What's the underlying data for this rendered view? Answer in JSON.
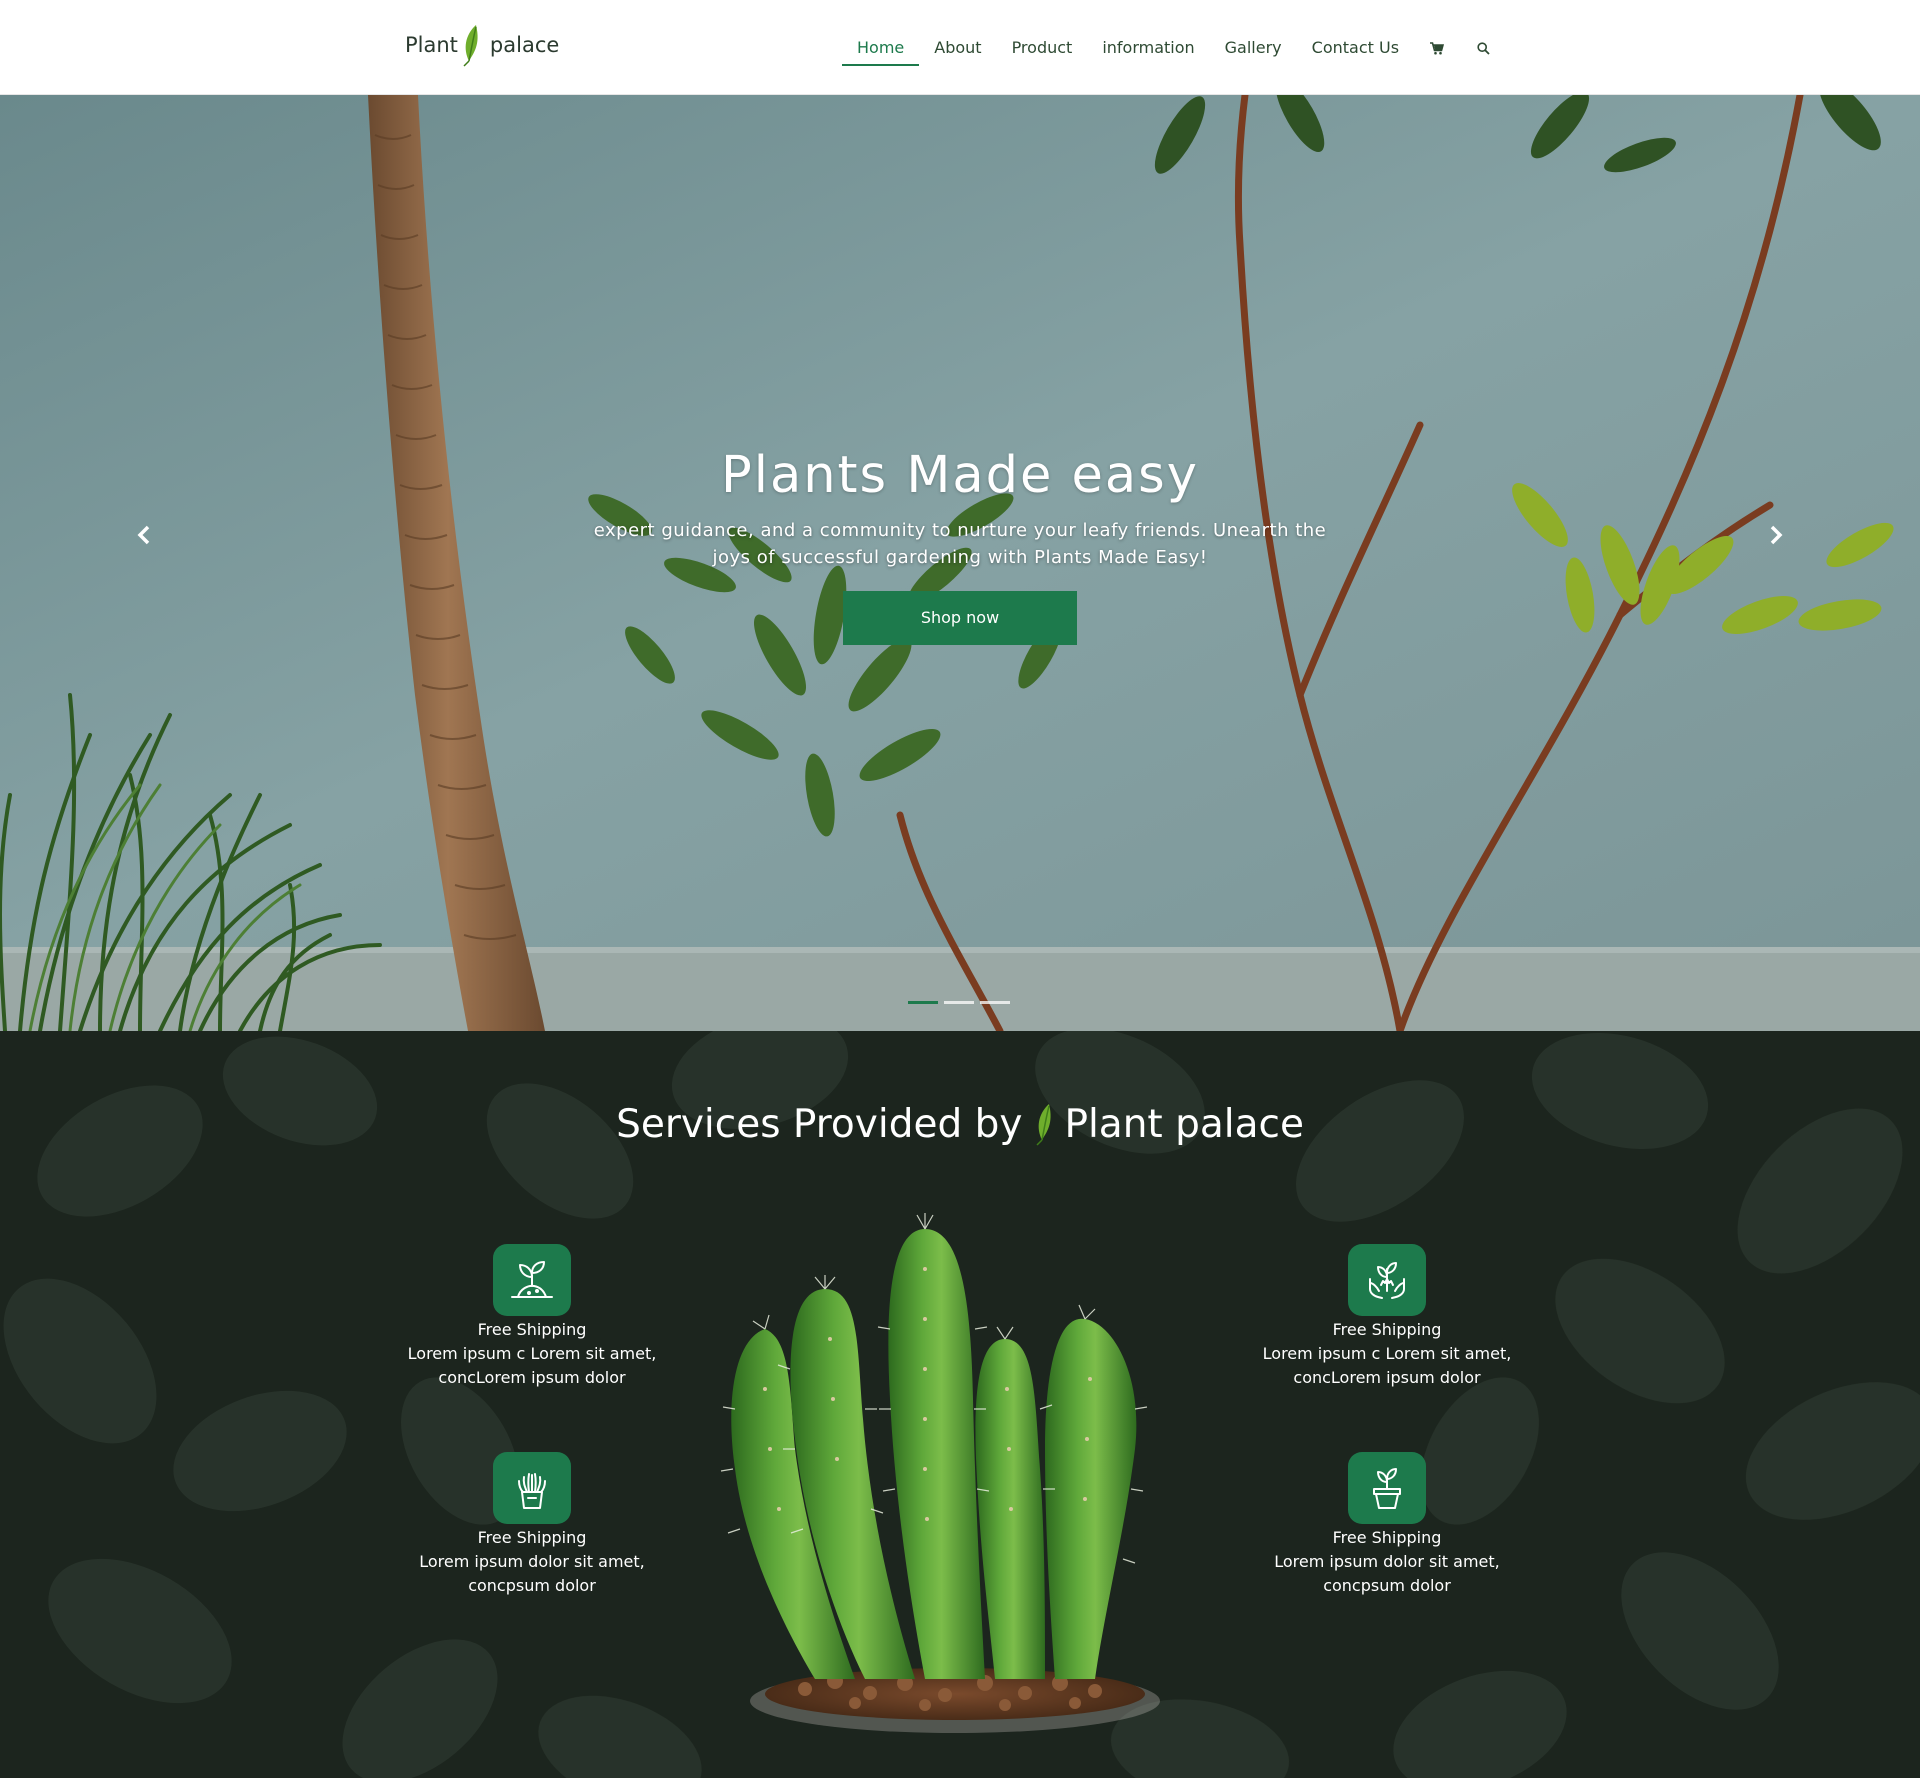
{
  "header": {
    "logo": {
      "word1": "Plant",
      "word2": "palace"
    },
    "nav": [
      {
        "label": "Home",
        "active": true
      },
      {
        "label": "About",
        "active": false
      },
      {
        "label": "Product",
        "active": false
      },
      {
        "label": "information",
        "active": false
      },
      {
        "label": "Gallery",
        "active": false
      },
      {
        "label": "Contact Us",
        "active": false
      }
    ],
    "icons": [
      "cart-icon",
      "search-icon"
    ]
  },
  "hero": {
    "title": "Plants Made easy",
    "subtitle": "expert guidance, and a community to nurture your leafy friends. Unearth the joys of successful gardening with Plants Made Easy!",
    "button": "Shop now",
    "slides": {
      "count": 3,
      "active": 1
    }
  },
  "services": {
    "title_prefix": "Services Provided by",
    "title_brand": "Plant palace",
    "features": [
      {
        "icon": "sprout-icon",
        "title": "Free Shipping",
        "text": "Lorem ipsum c Lorem sit amet, concLorem ipsum dolor"
      },
      {
        "icon": "plant-hands-icon",
        "title": "Free Shipping",
        "text": "Lorem ipsum c Lorem sit amet, concLorem ipsum dolor"
      },
      {
        "icon": "potted-plant-icon",
        "title": "Free Shipping",
        "text": "Lorem ipsum dolor sit amet, concpsum dolor"
      },
      {
        "icon": "flower-pot-icon",
        "title": "Free Shipping",
        "text": "Lorem ipsum dolor sit amet, concpsum dolor"
      }
    ]
  },
  "colors": {
    "brand_green": "#1d7a4c",
    "leaf_green": "#6fae2c",
    "dark_bg": "#1b241d",
    "wall": "#809c9f"
  }
}
